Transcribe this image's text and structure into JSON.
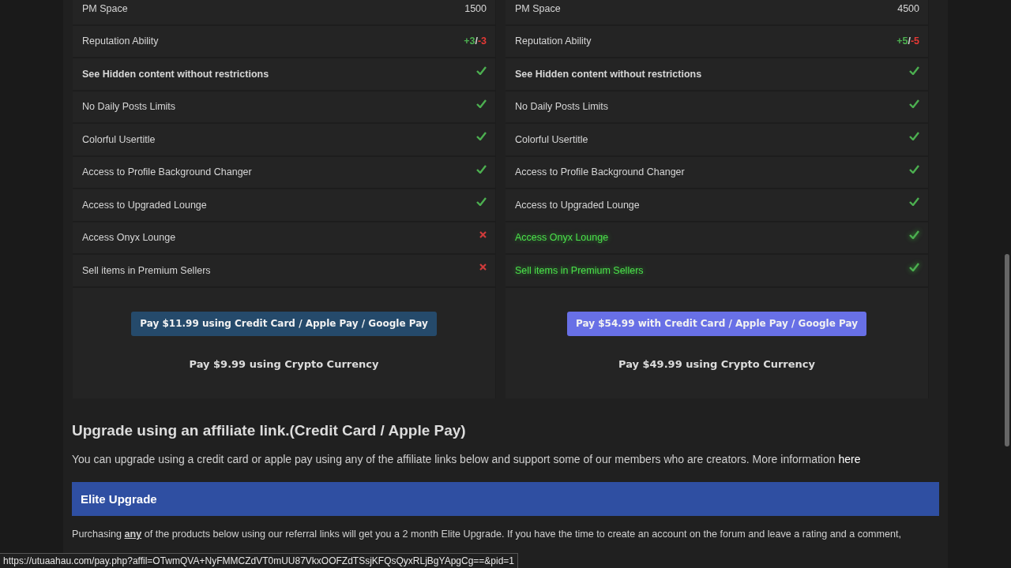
{
  "plans": [
    {
      "rows": [
        {
          "label": "PM Space",
          "kind": "text",
          "value": "1500",
          "bold": false,
          "highlight": false
        },
        {
          "label": "Reputation Ability",
          "kind": "rep",
          "plus": "+3",
          "slash": "/",
          "minus": "-3",
          "bold": false,
          "highlight": false
        },
        {
          "label": "See Hidden content without restrictions",
          "kind": "check",
          "included": true,
          "bold": true,
          "highlight": false
        },
        {
          "label": "No Daily Posts Limits",
          "kind": "check",
          "included": true,
          "bold": false,
          "highlight": false
        },
        {
          "label": "Colorful Usertitle",
          "kind": "check",
          "included": true,
          "bold": false,
          "highlight": false
        },
        {
          "label": "Access to Profile Background Changer",
          "kind": "check",
          "included": true,
          "bold": false,
          "highlight": false
        },
        {
          "label": "Access to Upgraded Lounge",
          "kind": "check",
          "included": true,
          "bold": false,
          "highlight": false
        },
        {
          "label": "Access Onyx Lounge",
          "kind": "check",
          "included": false,
          "bold": false,
          "highlight": false
        },
        {
          "label": "Sell items in Premium Sellers",
          "kind": "check",
          "included": false,
          "bold": false,
          "highlight": false
        }
      ],
      "pay_button": {
        "label": "Pay $11.99 using Credit Card / Apple Pay / Google Pay",
        "color": "#254a6b"
      },
      "crypto": "Pay $9.99 using Crypto Currency"
    },
    {
      "rows": [
        {
          "label": "PM Space",
          "kind": "text",
          "value": "4500",
          "bold": false,
          "highlight": false
        },
        {
          "label": "Reputation Ability",
          "kind": "rep",
          "plus": "+5",
          "slash": "/",
          "minus": "-5",
          "bold": false,
          "highlight": false
        },
        {
          "label": "See Hidden content without restrictions",
          "kind": "check",
          "included": true,
          "bold": true,
          "highlight": false
        },
        {
          "label": "No Daily Posts Limits",
          "kind": "check",
          "included": true,
          "bold": false,
          "highlight": false
        },
        {
          "label": "Colorful Usertitle",
          "kind": "check",
          "included": true,
          "bold": false,
          "highlight": false
        },
        {
          "label": "Access to Profile Background Changer",
          "kind": "check",
          "included": true,
          "bold": false,
          "highlight": false
        },
        {
          "label": "Access to Upgraded Lounge",
          "kind": "check",
          "included": true,
          "bold": false,
          "highlight": false
        },
        {
          "label": "Access Onyx Lounge",
          "kind": "check",
          "included": true,
          "bold": false,
          "highlight": true
        },
        {
          "label": "Sell items in Premium Sellers",
          "kind": "check",
          "included": true,
          "bold": false,
          "highlight": true
        }
      ],
      "pay_button": {
        "label": "Pay $54.99 with Credit Card / Apple Pay / Google Pay",
        "color": "#6870e6"
      },
      "crypto": "Pay $49.99 using Crypto Currency"
    }
  ],
  "affiliate": {
    "heading": "Upgrade using an affiliate link.(Credit Card / Apple Pay)",
    "intro": "You can upgrade using a credit card or apple pay using any of the affiliate links below and support some of our members who are creators. More information ",
    "intro_link": "here",
    "banner": "Elite Upgrade",
    "body": "Purchasing **any** of the products below using our referral links will get you a 2 month Elite Upgrade. If you have the time to create an account on the forum and leave a rating and a comment,"
  },
  "status_bar": "https://utuaahau.com/pay.php?affil=OTwmQVA+NyFMMCZdVT0mUU87VkxOOFZdTSsjKFQsQyxRLjBgYApgCg==&pid=1"
}
